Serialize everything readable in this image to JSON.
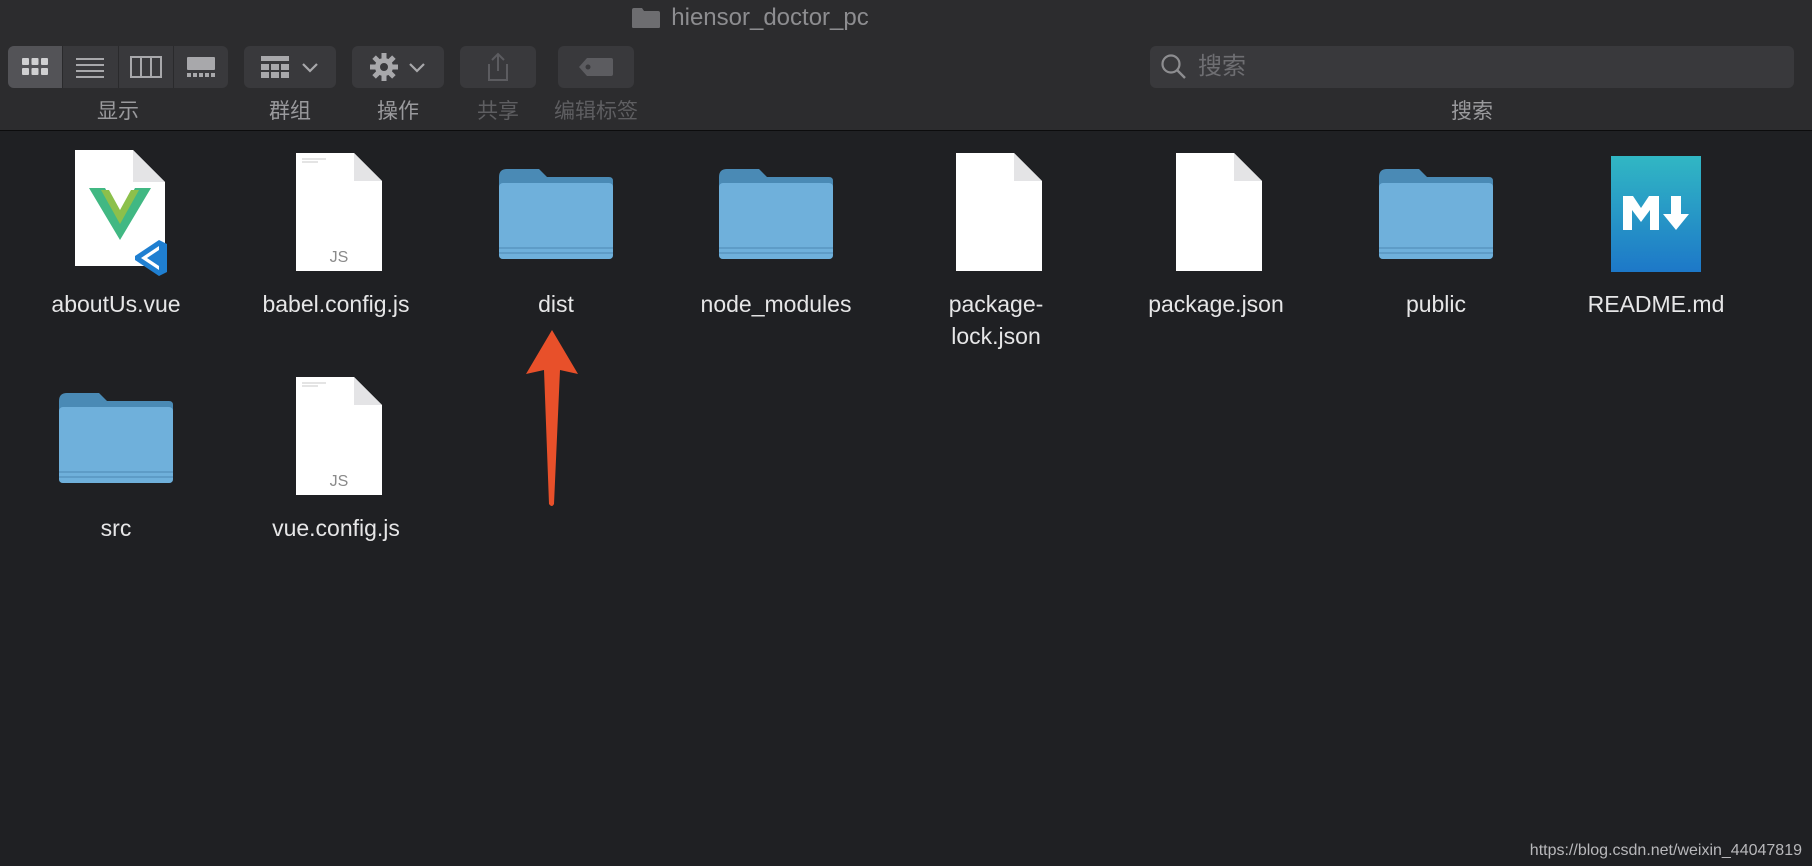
{
  "window": {
    "title": "hiensor_doctor_pc"
  },
  "toolbar": {
    "view_label": "显示",
    "group_label": "群组",
    "action_label": "操作",
    "share_label": "共享",
    "tags_label": "编辑标签",
    "search_label": "搜索",
    "search_placeholder": "搜索"
  },
  "files": [
    {
      "name": "aboutUs.vue",
      "kind": "vue-file"
    },
    {
      "name": "babel.config.js",
      "kind": "js-file"
    },
    {
      "name": "dist",
      "kind": "folder"
    },
    {
      "name": "node_modules",
      "kind": "folder"
    },
    {
      "name": "package-lock.json",
      "kind": "blank-file"
    },
    {
      "name": "package.json",
      "kind": "blank-file"
    },
    {
      "name": "public",
      "kind": "folder"
    },
    {
      "name": "README.md",
      "kind": "markdown-file"
    },
    {
      "name": "src",
      "kind": "folder"
    },
    {
      "name": "vue.config.js",
      "kind": "js-file"
    }
  ],
  "icons": {
    "js_badge": "JS"
  },
  "annotation": {
    "arrow_color": "#e8502a"
  },
  "watermark": "https://blog.csdn.net/weixin_44047819"
}
